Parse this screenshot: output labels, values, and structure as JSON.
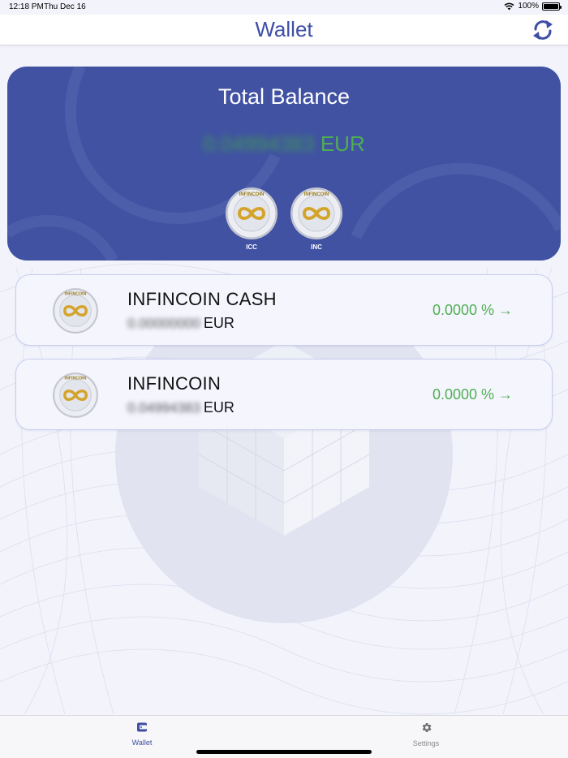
{
  "status_bar": {
    "time": "12:18 PM",
    "date": "Thu Dec 16",
    "battery": "100%",
    "wifi_icon": "wifi-icon",
    "battery_icon": "battery-icon"
  },
  "nav": {
    "title": "Wallet",
    "refresh_icon": "refresh-icon"
  },
  "balance": {
    "title": "Total Balance",
    "amount": "0.04994383",
    "currency": "EUR",
    "coins": [
      {
        "label": "ICC",
        "coin_text": "INFINCOIN"
      },
      {
        "label": "INC",
        "coin_text": "INFINCOIN"
      }
    ]
  },
  "coins": [
    {
      "name": "INFINCOIN CASH",
      "amount": "0.00000000",
      "currency": "EUR",
      "change": "0.0000 % →",
      "coin_text": "INFINCOIN"
    },
    {
      "name": "INFINCOIN",
      "amount": "0.04994383",
      "currency": "EUR",
      "change": "0.0000 % →",
      "coin_text": "INFINCOIN"
    }
  ],
  "tabs": [
    {
      "label": "Wallet",
      "icon": "wallet-icon",
      "active": true
    },
    {
      "label": "Settings",
      "icon": "gear-icon",
      "active": false
    }
  ],
  "colors": {
    "accent": "#3e4ea4",
    "card": "#4152a3",
    "positive": "#4fae52",
    "coin_gold": "#d4a42a",
    "coin_silver": "#d9dbe2"
  }
}
